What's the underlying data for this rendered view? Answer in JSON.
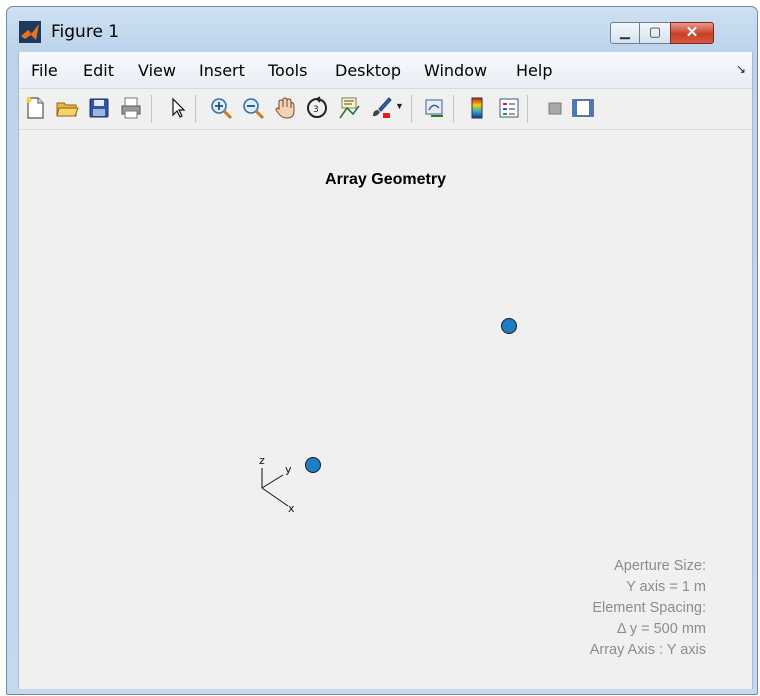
{
  "window": {
    "title": "Figure 1",
    "controls": {
      "minimize_glyph": "▁",
      "maximize_glyph": "▢",
      "close_glyph": "✕"
    }
  },
  "menubar": {
    "items": [
      "File",
      "Edit",
      "View",
      "Insert",
      "Tools",
      "Desktop",
      "Window",
      "Help"
    ],
    "overflow_glyph": "↘"
  },
  "toolbar": {
    "icons": [
      "new-figure-icon",
      "open-file-icon",
      "save-figure-icon",
      "print-figure-icon",
      "edit-plot-arrow-icon",
      "zoom-in-icon",
      "zoom-out-icon",
      "pan-hand-icon",
      "rotate-3d-icon",
      "data-cursor-icon",
      "brush-icon",
      "brush-dropdown-icon",
      "link-plot-icon",
      "insert-colorbar-icon",
      "insert-legend-icon",
      "hide-plot-tools-icon",
      "show-plot-tools-icon"
    ]
  },
  "plot": {
    "title": "Array Geometry",
    "elements_colour": "#1e7ec4",
    "triad": {
      "z": "z",
      "y": "y",
      "x": "x"
    },
    "annotation": {
      "line1": "Aperture Size:",
      "line2": "Y axis = 1 m",
      "line3": "Element Spacing:",
      "line4": "Δ y = 500 mm",
      "line5": "Array Axis : Y axis"
    }
  }
}
